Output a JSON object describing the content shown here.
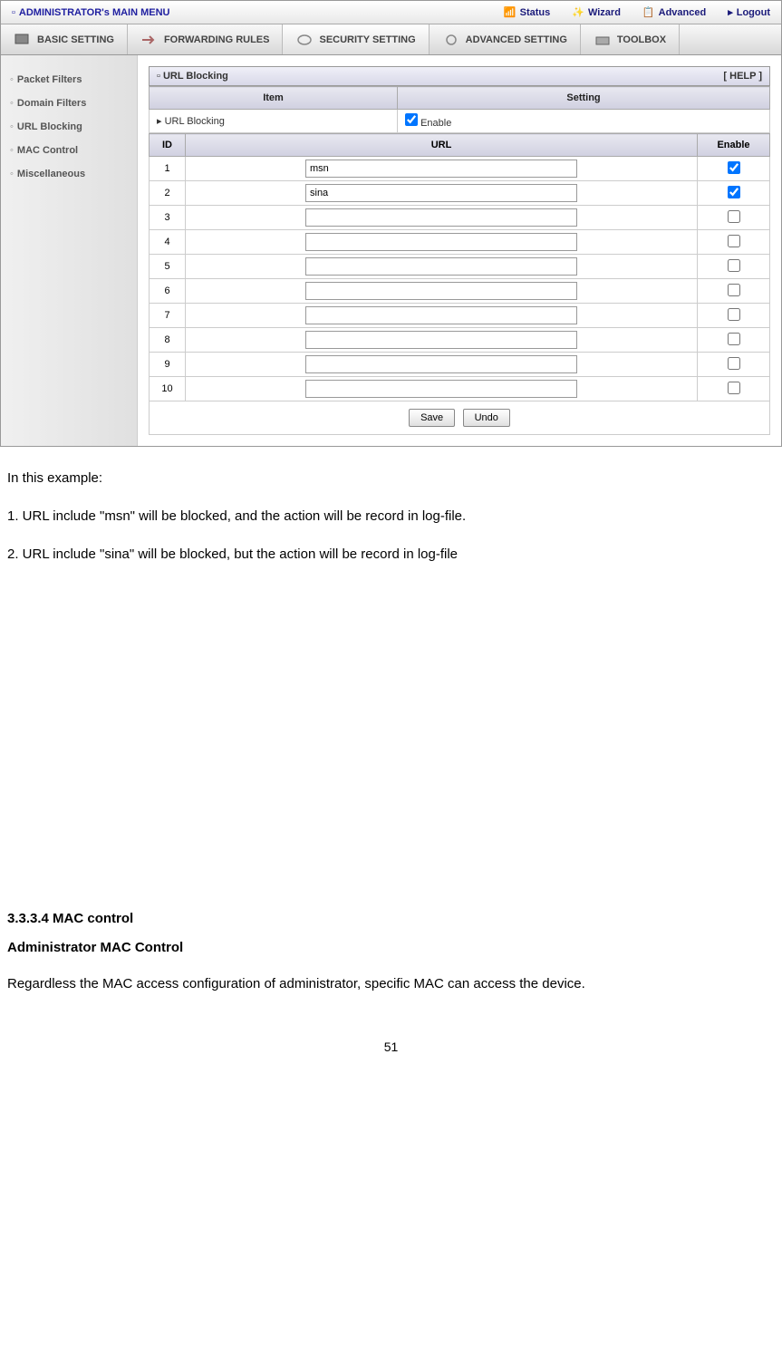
{
  "topMenu": {
    "main": "ADMINISTRATOR's MAIN MENU",
    "status": "Status",
    "wizard": "Wizard",
    "advanced": "Advanced",
    "logout": "Logout"
  },
  "tabs": {
    "basic": "BASIC SETTING",
    "forwarding": "FORWARDING RULES",
    "security": "SECURITY SETTING",
    "advanced": "ADVANCED SETTING",
    "toolbox": "TOOLBOX"
  },
  "sidebar": {
    "items": [
      "Packet Filters",
      "Domain Filters",
      "URL Blocking",
      "MAC Control",
      "Miscellaneous"
    ]
  },
  "panel": {
    "title": "URL Blocking",
    "help": "[ HELP ]",
    "itemHeader": "Item",
    "settingHeader": "Setting",
    "urlBlockingLabel": "URL Blocking",
    "enableLabel": "Enable",
    "idHeader": "ID",
    "urlHeader": "URL",
    "enableHeader": "Enable",
    "rows": [
      {
        "id": "1",
        "url": "msn",
        "enabled": true
      },
      {
        "id": "2",
        "url": "sina",
        "enabled": true
      },
      {
        "id": "3",
        "url": "",
        "enabled": false
      },
      {
        "id": "4",
        "url": "",
        "enabled": false
      },
      {
        "id": "5",
        "url": "",
        "enabled": false
      },
      {
        "id": "6",
        "url": "",
        "enabled": false
      },
      {
        "id": "7",
        "url": "",
        "enabled": false
      },
      {
        "id": "8",
        "url": "",
        "enabled": false
      },
      {
        "id": "9",
        "url": "",
        "enabled": false
      },
      {
        "id": "10",
        "url": "",
        "enabled": false
      }
    ],
    "saveBtn": "Save",
    "undoBtn": "Undo"
  },
  "doc": {
    "intro": "In this example:",
    "line1": "1. URL include \"msn\" will be blocked, and the action will be record in log-file.",
    "line2": "2. URL include \"sina\" will be blocked, but the action will be record in log-file",
    "section": "3.3.3.4 MAC control",
    "subtitle": "Administrator MAC Control",
    "body": "Regardless the MAC access configuration of administrator, specific MAC can access the device.",
    "pageNum": "51"
  }
}
